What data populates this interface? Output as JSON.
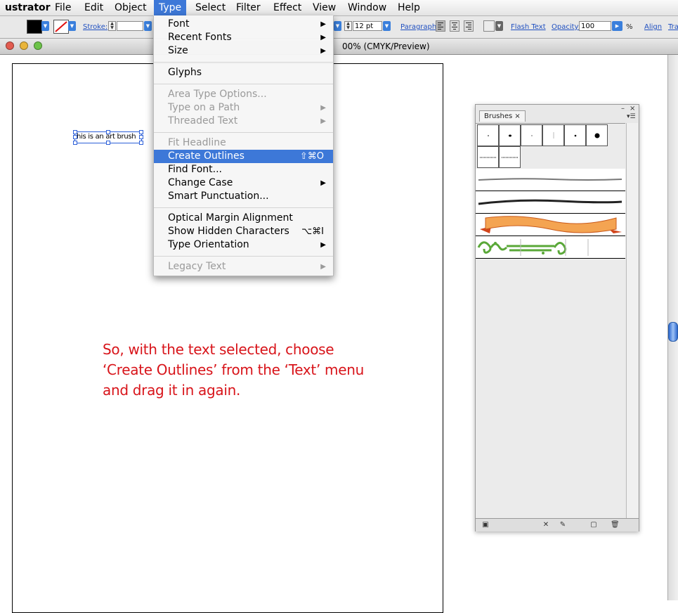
{
  "menubar": {
    "items": [
      "ustrator",
      "File",
      "Edit",
      "Object",
      "Type",
      "Select",
      "Filter",
      "Effect",
      "View",
      "Window",
      "Help"
    ],
    "active": "Type"
  },
  "controlbar": {
    "stroke_label": "Stroke:",
    "font_size": "12 pt",
    "paragraph_label": "Paragraph:",
    "flash_text": "Flash Text",
    "opacity_label": "Opacity:",
    "opacity_value": "100",
    "percent": "%",
    "align_label": "Align",
    "trailing_label": "Tra",
    "fill_color": "#000000",
    "accent_color": "#3a7fdc"
  },
  "document": {
    "title": "00% (CMYK/Preview)",
    "selected_text": "his is an art brush"
  },
  "type_menu": {
    "items": [
      {
        "label": "Font",
        "submenu": true
      },
      {
        "label": "Recent Fonts",
        "submenu": true
      },
      {
        "label": "Size",
        "submenu": true
      },
      {
        "label": "Glyphs"
      },
      {
        "label": "Area Type Options...",
        "disabled": true
      },
      {
        "label": "Type on a Path",
        "submenu": true,
        "disabled": true
      },
      {
        "label": "Threaded Text",
        "submenu": true,
        "disabled": true
      },
      {
        "label": "Fit Headline",
        "disabled": true
      },
      {
        "label": "Create Outlines",
        "shortcut": "⇧⌘O",
        "highlighted": true
      },
      {
        "label": "Find Font..."
      },
      {
        "label": "Change Case",
        "submenu": true
      },
      {
        "label": "Smart Punctuation..."
      },
      {
        "label": "Optical Margin Alignment"
      },
      {
        "label": "Show Hidden Characters",
        "shortcut": "⌥⌘I"
      },
      {
        "label": "Type Orientation",
        "submenu": true
      },
      {
        "label": "Legacy Text",
        "submenu": true,
        "disabled": true
      }
    ],
    "highlight_color": "#3d78d8"
  },
  "annotation": {
    "lines": [
      "So, with the text selected, choose",
      "‘Create Outlines’ from the ‘Text’ menu",
      "and drag it in again."
    ],
    "color": "#d8141a"
  },
  "brushes_panel": {
    "tab_label": "Brushes",
    "close_glyph": "×"
  }
}
